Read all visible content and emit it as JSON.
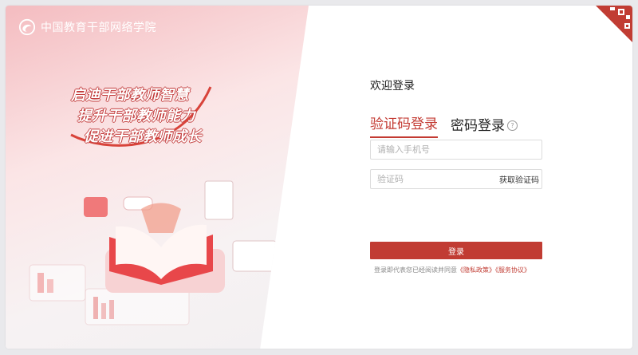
{
  "brand": {
    "name": "中国教育干部网络学院"
  },
  "slogan": [
    "启迪干部教师智慧",
    "提升干部教师能力",
    "促进干部教师成长"
  ],
  "login": {
    "welcome": "欢迎登录",
    "tabs": [
      {
        "label": "验证码登录",
        "active": true
      },
      {
        "label": "密码登录",
        "active": false
      }
    ],
    "help_icon": "?",
    "phone_placeholder": "请输入手机号",
    "code_placeholder": "验证码",
    "get_code_label": "获取验证码",
    "submit_label": "登录",
    "agreement": {
      "prefix": "登录即代表您已经阅读并同意",
      "privacy": "《隐私政策》",
      "service": "《服务协议》"
    }
  },
  "icons": {
    "qr": "qr-code-icon",
    "logo": "logo-swirl-icon"
  },
  "colors": {
    "accent": "#c13c33",
    "hero_pink": "#f4bcc0"
  }
}
